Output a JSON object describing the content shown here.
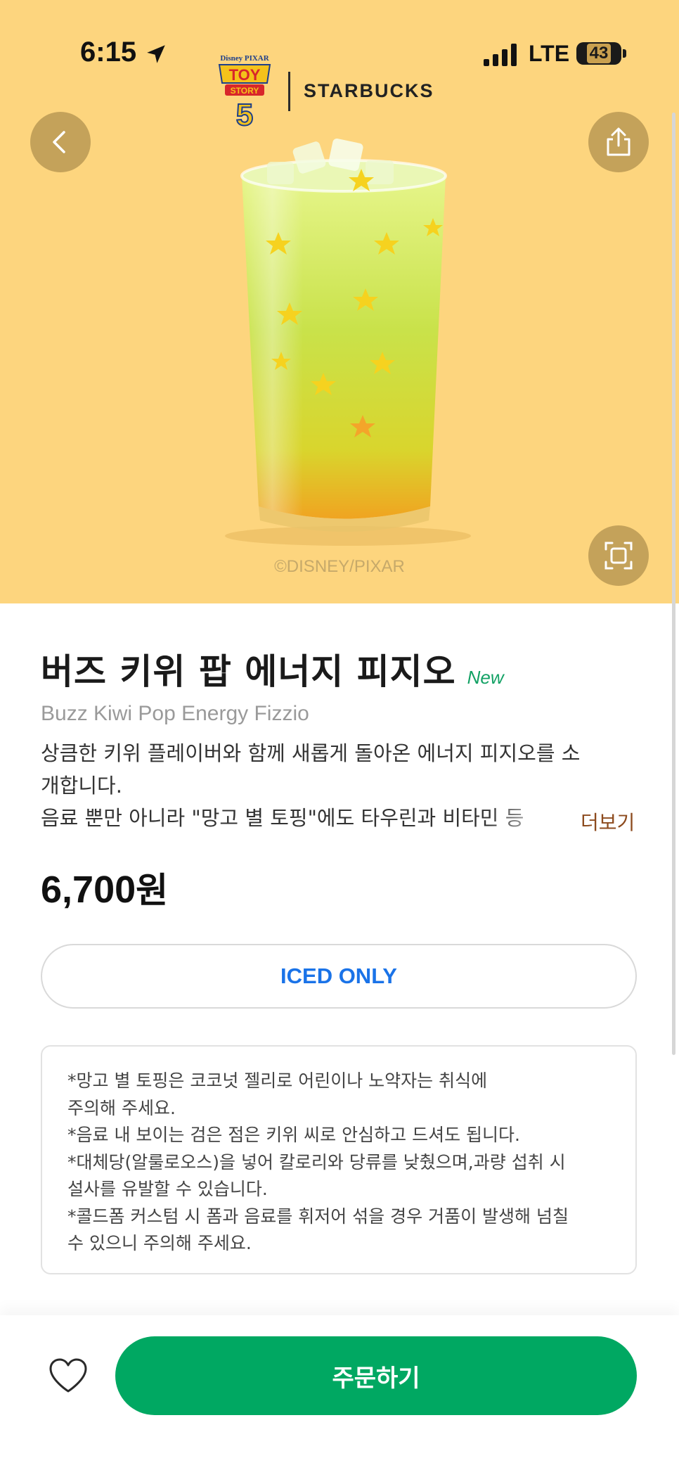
{
  "status_bar": {
    "time": "6:15",
    "network": "LTE",
    "battery": "43"
  },
  "brand": {
    "partner_logo_text": "TOY STORY 5",
    "partner_top_text": "Disney PIXAR",
    "starbucks_wordmark": "STARBUCKS"
  },
  "hero": {
    "credit": "©DISNEY/PIXAR",
    "background": "#fdd57e"
  },
  "product": {
    "name_ko": "버즈 키위 팝 에너지 피지오",
    "badge": "New",
    "name_en": "Buzz Kiwi Pop Energy Fizzio",
    "description_lines": [
      "상큼한 키위 플레이버와 함께 새롭게 돌아온 에너지 피지오를 소",
      "개합니다.",
      "음료 뿐만 아니라 \"망고 별 토핑\"에도 타우린과 비타민 등"
    ],
    "more_label": "더보기",
    "price": "6,700",
    "currency": "원",
    "temperature_option": "ICED ONLY"
  },
  "notice": {
    "lines": [
      "*망고 별 토핑은 코코넛 젤리로 어린이나 노약자는 취식에",
      "주의해 주세요.",
      "*음료 내 보이는 검은 점은 키위 씨로 안심하고 드셔도 됩니다.",
      "*대체당(알룰로오스)을 넣어 칼로리와 당류를 낮췄으며,과량 섭취 시",
      "설사를 유발할 수 있습니다.",
      "*콜드폼 커스텀 시 폼과 음료를 휘저어 섞을 경우 거품이 발생해 넘칠",
      "수 있으니 주의해 주세요."
    ]
  },
  "actions": {
    "order_label": "주문하기"
  },
  "colors": {
    "accent_green": "#00a862",
    "new_badge": "#12a164",
    "iced_text": "#1a73e8",
    "more_text": "#8c4a1d"
  },
  "icons": {
    "back": "chevron-left-icon",
    "share": "share-icon",
    "fullscreen": "fullscreen-icon",
    "favorite": "heart-icon",
    "location": "location-arrow-icon",
    "signal": "signal-icon",
    "battery": "battery-icon"
  }
}
